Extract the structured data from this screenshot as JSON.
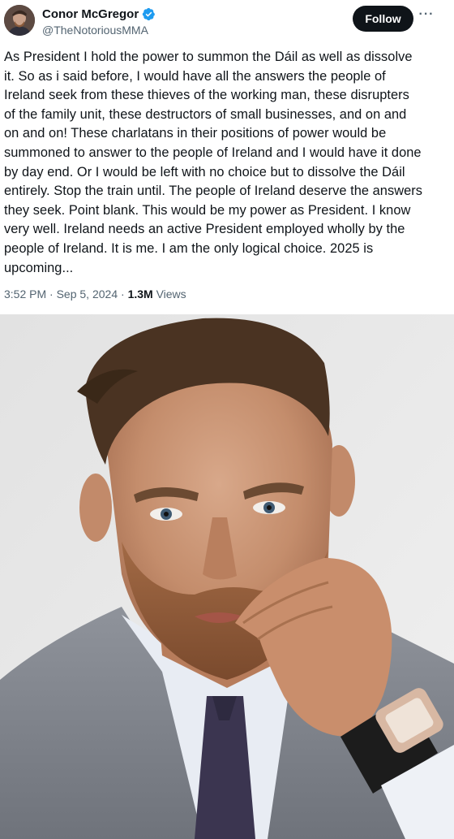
{
  "author": {
    "display_name": "Conor McGregor",
    "handle": "@TheNotoriousMMA",
    "verified": true,
    "verified_icon": "verified-badge-icon",
    "avatar_icon": "avatar"
  },
  "actions": {
    "follow_label": "Follow",
    "more_label": "···"
  },
  "tweet": {
    "lines": [
      "As President I hold the power to summon the Dáil as well as dissolve",
      "it. So as i said before, I would have all the answers the people of",
      "Ireland seek from these thieves of the working man, these disrupters",
      "of the family unit, these destructors of small businesses, and on and",
      "on and on! These charlatans in their positions of power would be",
      "summoned to answer to the people of Ireland and I would have it done",
      "by day end. Or I would be left with no choice but to dissolve the Dáil",
      "entirely. Stop the train until. The people of Ireland deserve the answers",
      "they seek. Point blank. This would be my power as President. I know",
      "very well. Ireland needs an active President employed wholly by the",
      "people of Ireland. It is me. I am the only logical choice. 2025 is",
      "upcoming..."
    ]
  },
  "meta": {
    "time": "3:52 PM",
    "separator": "·",
    "date": "Sep 5, 2024",
    "views_count": "1.3M",
    "views_label": "Views"
  },
  "colors": {
    "text": "#0f1419",
    "secondary": "#536471",
    "follow_bg": "#0f1419",
    "verified": "#1d9bf0"
  }
}
